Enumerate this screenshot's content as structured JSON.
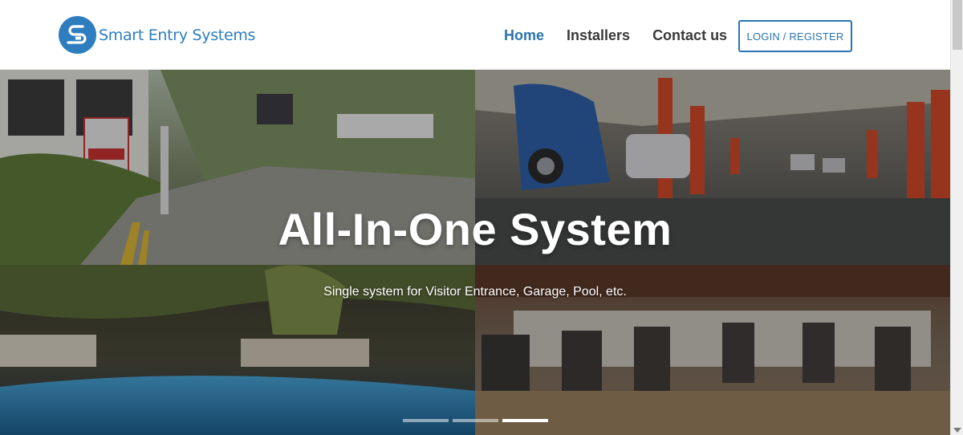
{
  "header": {
    "logo_text": "Smart Entry Systems",
    "nav": [
      {
        "label": "Home",
        "active": true
      },
      {
        "label": "Installers",
        "active": false
      },
      {
        "label": "Contact us",
        "active": false
      }
    ],
    "login_label": "LOGIN / REGISTER"
  },
  "hero": {
    "title": "All-In-One System",
    "subtitle": "Single system for Visitor Entrance, Garage, Pool, etc.",
    "slides": 3,
    "active_slide": 3
  },
  "colors": {
    "brand": "#2e7dbe",
    "nav_active": "#2a74b0",
    "nav_text": "#3a3a3a"
  }
}
